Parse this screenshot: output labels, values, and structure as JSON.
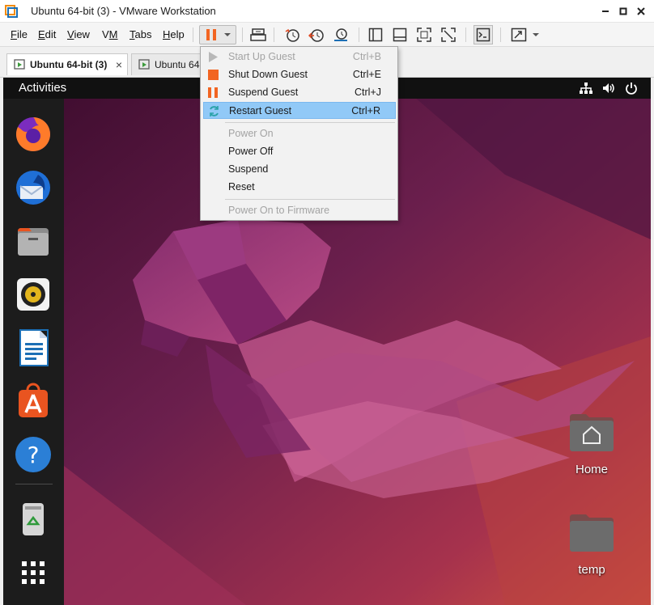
{
  "window": {
    "title": "Ubuntu 64-bit (3) - VMware Workstation"
  },
  "menubar": {
    "items": [
      {
        "label": "File",
        "accel": "F",
        "rest": "ile"
      },
      {
        "label": "Edit",
        "accel": "E",
        "rest": "dit"
      },
      {
        "label": "View",
        "accel": "V",
        "rest": "iew"
      },
      {
        "label": "VM",
        "accel": "M",
        "pre": "V"
      },
      {
        "label": "Tabs",
        "accel": "T",
        "rest": "abs"
      },
      {
        "label": "Help",
        "accel": "H",
        "rest": "elp"
      }
    ]
  },
  "tabs": [
    {
      "label": "Ubuntu 64-bit (3)",
      "active": true
    },
    {
      "label": "Ubuntu 64-b",
      "active": false
    }
  ],
  "power_menu": {
    "items": [
      {
        "label": "Start Up Guest",
        "shortcut": "Ctrl+B",
        "icon": "play-icon",
        "disabled": true
      },
      {
        "label": "Shut Down Guest",
        "shortcut": "Ctrl+E",
        "icon": "stop-icon",
        "disabled": false
      },
      {
        "label": "Suspend Guest",
        "shortcut": "Ctrl+J",
        "icon": "pause-icon",
        "disabled": false
      },
      {
        "label": "Restart Guest",
        "shortcut": "Ctrl+R",
        "icon": "restart-icon",
        "disabled": false,
        "highlighted": true
      },
      {
        "label": "Power On",
        "shortcut": "",
        "disabled": true
      },
      {
        "label": "Power Off",
        "shortcut": "",
        "disabled": false
      },
      {
        "label": "Suspend",
        "shortcut": "",
        "disabled": false
      },
      {
        "label": "Reset",
        "shortcut": "",
        "disabled": false
      },
      {
        "label": "Power On to Firmware",
        "shortcut": "",
        "disabled": true
      }
    ]
  },
  "guest": {
    "topbar": {
      "activities": "Activities"
    },
    "dock": [
      "firefox-icon",
      "thunderbird-icon",
      "files-icon",
      "rhythmbox-icon",
      "libreoffice-writer-icon",
      "app-center-icon",
      "help-icon",
      "trash-icon",
      "show-apps-icon"
    ],
    "desktop_icons": [
      {
        "label": "Home"
      },
      {
        "label": "temp"
      }
    ]
  },
  "colors": {
    "pause_orange": "#f26522",
    "menu_highlight": "#91c9f7",
    "ubuntu_purple": "#5e2750",
    "ubuntu_orange": "#e95420"
  }
}
